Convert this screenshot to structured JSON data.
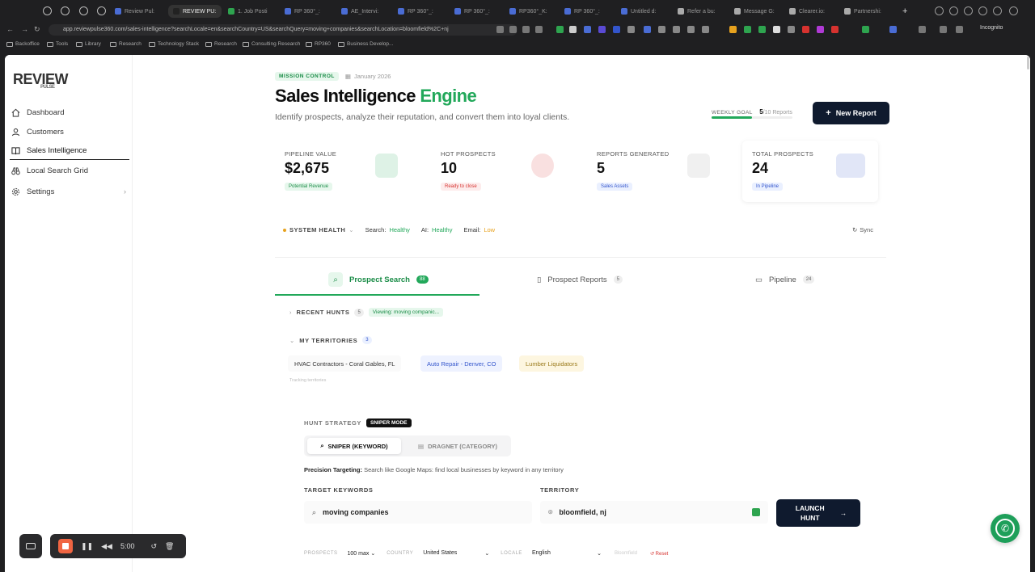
{
  "browser": {
    "tabs": [
      "Review Pul:",
      "REVIEW PU:",
      "1. Job Posti",
      "RP 360°_:",
      "AE_Intervi:",
      "RP 360°_:",
      "RP 360°_:",
      "RP360°_K:",
      "RP 360°_:",
      "Untitled d:",
      "Refer a bu:",
      "Message G:",
      "Clearer.io:",
      "Partnershi:"
    ],
    "url": "app.reviewpulse360.com/sales-intelligence?searchLocale=en&searchCountry=US&searchQuery=moving+companies&searchLocation=bloomfield%2C+nj",
    "incognito": "Incognito",
    "bookmarks": [
      "Backoffice",
      "Tools",
      "Library",
      "Research",
      "Technology Stack",
      "Research",
      "Consulting Research",
      "RP360",
      "Business Develop..."
    ]
  },
  "sidebar": {
    "logo": "REVIEW",
    "logo_sub": "PULSE",
    "items": [
      {
        "label": "Dashboard",
        "icon": "home-icon"
      },
      {
        "label": "Customers",
        "icon": "user-icon"
      },
      {
        "label": "Sales Intelligence",
        "icon": "book-icon"
      },
      {
        "label": "Local Search Grid",
        "icon": "binoculars-icon"
      },
      {
        "label": "Settings",
        "icon": "gear-icon"
      }
    ]
  },
  "header": {
    "badge": "MISSION CONTROL",
    "date": "January 2026",
    "title_main": "Sales Intelligence",
    "title_accent": "Engine",
    "subtitle": "Identify prospects, analyze their reputation, and convert them into loyal clients.",
    "weekly_goal_label": "WEEKLY GOAL",
    "weekly_goal_value": "5",
    "weekly_goal_rest": "/10 Reports",
    "weekly_goal_progress": 0.5,
    "new_report": "New Report"
  },
  "stats": [
    {
      "label": "PIPELINE VALUE",
      "value": "$2,675",
      "tag": "Potential Revenue",
      "color": "#1a8c47",
      "bg": "#e6f7ec"
    },
    {
      "label": "HOT PROSPECTS",
      "value": "10",
      "tag": "Ready to close",
      "color": "#d6322f",
      "bg": "#fdecec"
    },
    {
      "label": "REPORTS GENERATED",
      "value": "5",
      "tag": "Sales Assets",
      "color": "#3355cc",
      "bg": "#eaf0ff"
    },
    {
      "label": "TOTAL PROSPECTS",
      "value": "24",
      "tag": "In Pipeline",
      "color": "#3355cc",
      "bg": "#eaf0ff"
    }
  ],
  "health": {
    "label": "SYSTEM HEALTH",
    "search_label": "Search:",
    "search": "Healthy",
    "ai_label": "AI:",
    "ai": "Healthy",
    "email_label": "Email:",
    "email": "Low",
    "sync": "Sync"
  },
  "tabs": [
    {
      "label": "Prospect Search",
      "count": "88"
    },
    {
      "label": "Prospect Reports",
      "count": "5"
    },
    {
      "label": "Pipeline",
      "count": "24"
    }
  ],
  "recent": {
    "label": "RECENT HUNTS",
    "count": "5",
    "viewing": "Viewing: moving companic..."
  },
  "territories": {
    "label": "MY TERRITORIES",
    "count": "3",
    "items": [
      "HVAC Contractors - Coral Gables, FL",
      "Auto Repair - Denver, CO",
      "Lumber Liquidators"
    ],
    "note": "Tracking territories"
  },
  "hunt": {
    "strategy_label": "HUNT STRATEGY",
    "mode": "SNIPER MODE",
    "sniper": "SNIPER (KEYWORD)",
    "dragnet": "DRAGNET (CATEGORY)",
    "precision_label": "Precision Targeting:",
    "precision_text": "Search like Google Maps: find local businesses by keyword in any territory",
    "keywords_label": "TARGET KEYWORDS",
    "keywords": "moving companies",
    "territory_label": "TERRITORY",
    "territory": "bloomfield, nj",
    "launch": "LAUNCH HUNT",
    "prospects_label": "PROSPECTS",
    "prospects": "100 max",
    "country_label": "COUNTRY",
    "country": "United States",
    "locale_label": "LOCALE",
    "locale": "English",
    "hidden_text": "Bloomfield",
    "reset": "Reset"
  },
  "recorder": {
    "time": "5:00"
  }
}
